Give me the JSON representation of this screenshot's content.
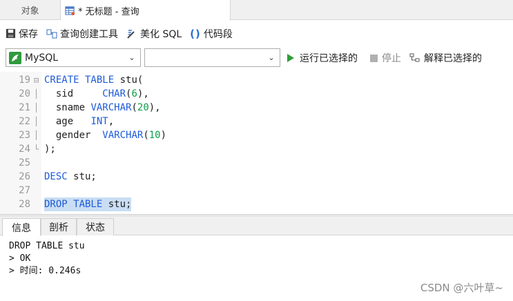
{
  "tabs": {
    "objects": "对象",
    "query": "* 无标题 - 查询"
  },
  "toolbar": {
    "save": "保存",
    "query_builder": "查询创建工具",
    "beautify": "美化 SQL",
    "snippet": "代码段"
  },
  "selectors": {
    "connection": "MySQL",
    "schema": ""
  },
  "actions": {
    "run_selected": "运行已选择的",
    "stop": "停止",
    "explain_selected": "解释已选择的"
  },
  "editor": {
    "lines": [
      {
        "n": "19",
        "text": "CREATE TABLE stu("
      },
      {
        "n": "20",
        "text": "  sid     CHAR(6),"
      },
      {
        "n": "21",
        "text": "  sname VARCHAR(20),"
      },
      {
        "n": "22",
        "text": "  age   INT,"
      },
      {
        "n": "23",
        "text": "  gender  VARCHAR(10)"
      },
      {
        "n": "24",
        "text": ");"
      },
      {
        "n": "25",
        "text": ""
      },
      {
        "n": "26",
        "text": "DESC stu;"
      },
      {
        "n": "27",
        "text": ""
      },
      {
        "n": "28",
        "text": "DROP TABLE stu;"
      }
    ]
  },
  "result_tabs": [
    "信息",
    "剖析",
    "状态"
  ],
  "output": {
    "line1": "DROP TABLE stu",
    "line2": "> OK",
    "line3": "> 时间: 0.246s"
  },
  "watermark": "CSDN @六叶草~",
  "colors": {
    "keyword": "#1e5bd6",
    "number": "#0a9f4a",
    "selection": "#c9ddf4",
    "run_green": "#2e9e3a"
  }
}
